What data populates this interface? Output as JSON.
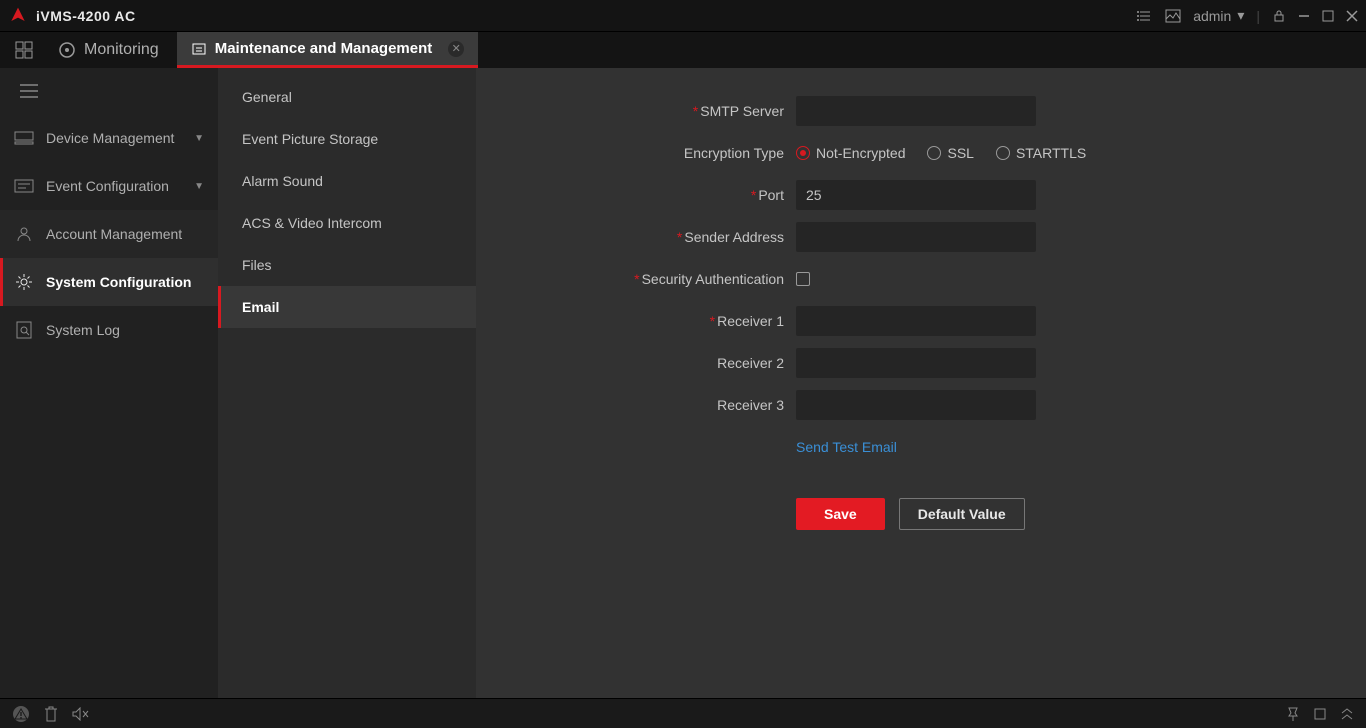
{
  "app": {
    "title": "iVMS-4200 AC",
    "user": "admin"
  },
  "tabs": {
    "monitoring": "Monitoring",
    "active": "Maintenance and Management"
  },
  "sidebar1": {
    "device_mgmt": "Device Management",
    "event_config": "Event Configuration",
    "account_mgmt": "Account Management",
    "system_config": "System Configuration",
    "system_log": "System Log"
  },
  "sidebar2": {
    "general": "General",
    "event_picture_storage": "Event Picture Storage",
    "alarm_sound": "Alarm Sound",
    "acs_video_intercom": "ACS & Video Intercom",
    "files": "Files",
    "email": "Email"
  },
  "form": {
    "labels": {
      "smtp_server": "SMTP Server",
      "encryption_type": "Encryption Type",
      "port": "Port",
      "sender_address": "Sender Address",
      "security_auth": "Security Authentication",
      "receiver1": "Receiver 1",
      "receiver2": "Receiver 2",
      "receiver3": "Receiver 3",
      "send_test": "Send Test Email"
    },
    "values": {
      "smtp_server": "",
      "port": "25",
      "sender_address": "",
      "receiver1": "",
      "receiver2": "",
      "receiver3": ""
    },
    "encryption_options": {
      "not_encrypted": "Not-Encrypted",
      "ssl": "SSL",
      "starttls": "STARTTLS"
    },
    "buttons": {
      "save": "Save",
      "default_value": "Default Value"
    }
  }
}
